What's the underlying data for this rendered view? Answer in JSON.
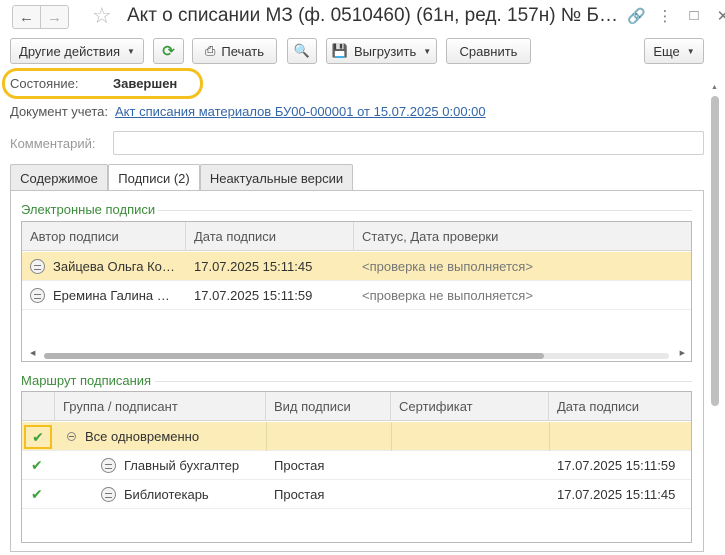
{
  "window": {
    "title": "Акт о списании МЗ (ф. 0510460) (61н, ред. 157н) № Б…",
    "back_icon": "arrow-left-icon",
    "forward_icon": "arrow-right-icon",
    "favorite_icon": "star-icon",
    "link_icon": "link-icon",
    "menu_icon": "more-vertical-icon",
    "maximize_icon": "maximize-icon",
    "close_icon": "close-icon"
  },
  "toolbar": {
    "other_actions": "Другие действия",
    "refresh_icon": "refresh-icon",
    "print": "Печать",
    "preview_icon": "print-preview-icon",
    "export": "Выгрузить",
    "compare": "Сравнить",
    "more": "Еще"
  },
  "state": {
    "label": "Состояние:",
    "value": "Завершен"
  },
  "document": {
    "label": "Документ учета:",
    "link": "Акт списания материалов БУ00-000001 от 15.07.2025 0:00:00"
  },
  "comment": {
    "label": "Комментарий:",
    "value": ""
  },
  "tabs": [
    {
      "label": "Содержимое",
      "active": false
    },
    {
      "label": "Подписи (2)",
      "active": true
    },
    {
      "label": "Неактуальные версии",
      "active": false
    }
  ],
  "signatures": {
    "title": "Электронные подписи",
    "columns": [
      "Автор подписи",
      "Дата подписи",
      "Статус, Дата проверки"
    ],
    "rows": [
      {
        "author": "Зайцева Ольга Ко…",
        "date": "17.07.2025 15:11:45",
        "status": "<проверка не выполняется>",
        "selected": true
      },
      {
        "author": "Еремина Галина …",
        "date": "17.07.2025 15:11:59",
        "status": "<проверка не выполняется>",
        "selected": false
      }
    ]
  },
  "route": {
    "title": "Маршрут подписания",
    "columns": [
      "",
      "Группа / подписант",
      "Вид подписи",
      "Сертификат",
      "Дата подписи"
    ],
    "rows": [
      {
        "checked": true,
        "group": "Все одновременно",
        "type": "",
        "cert": "",
        "date": "",
        "selected": true
      },
      {
        "checked": true,
        "group": "Главный бухгалтер",
        "type": "Простая",
        "cert": "",
        "date": "17.07.2025 15:11:59",
        "selected": false
      },
      {
        "checked": true,
        "group": "Библиотекарь",
        "type": "Простая",
        "cert": "",
        "date": "17.07.2025 15:11:45",
        "selected": false
      }
    ]
  },
  "colors": {
    "accent_green": "#3b8c3b",
    "link": "#3366a8",
    "highlight": "#f4c01e",
    "selected_row": "#fbecb8"
  }
}
